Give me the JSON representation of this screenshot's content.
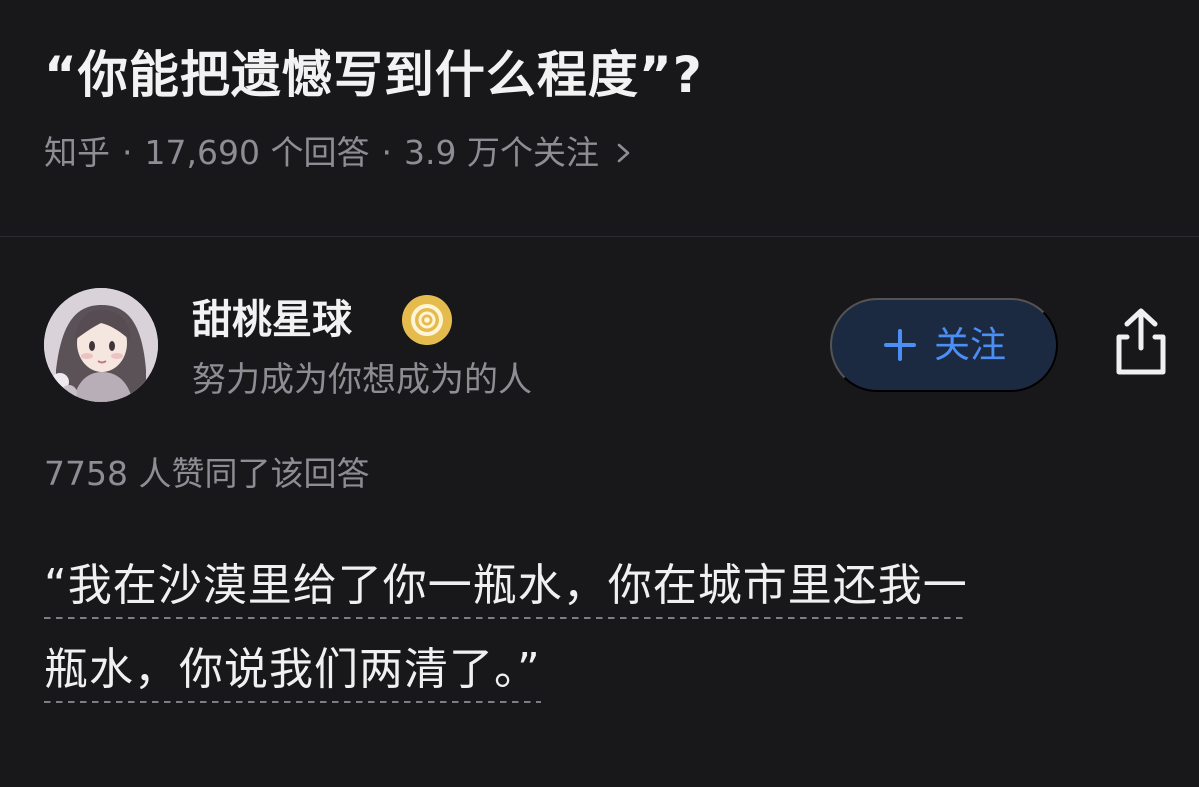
{
  "question": {
    "title": "“你能把遗憾写到什么程度”?",
    "source": "知乎",
    "answer_count": "17,690 个回答",
    "follower_count": "3.9 万个关注"
  },
  "author": {
    "name": "甜桃星球",
    "bio": "努力成为你想成为的人",
    "avatar_icon": "avatar-illustration",
    "badge_icon": "gold-badge-icon"
  },
  "actions": {
    "follow_label": "关注",
    "share_icon": "share-icon"
  },
  "answer": {
    "votes": "7758 人赞同了该回答",
    "lines": [
      "“我在沙漠里给了你一瓶水，你在城市里还我一",
      "瓶水，你说我们两清了。”"
    ]
  },
  "colors": {
    "background": "#18181b",
    "accent": "#4b8ff5",
    "follow_bg": "#1c2a41",
    "badge": "#e9bf52"
  }
}
